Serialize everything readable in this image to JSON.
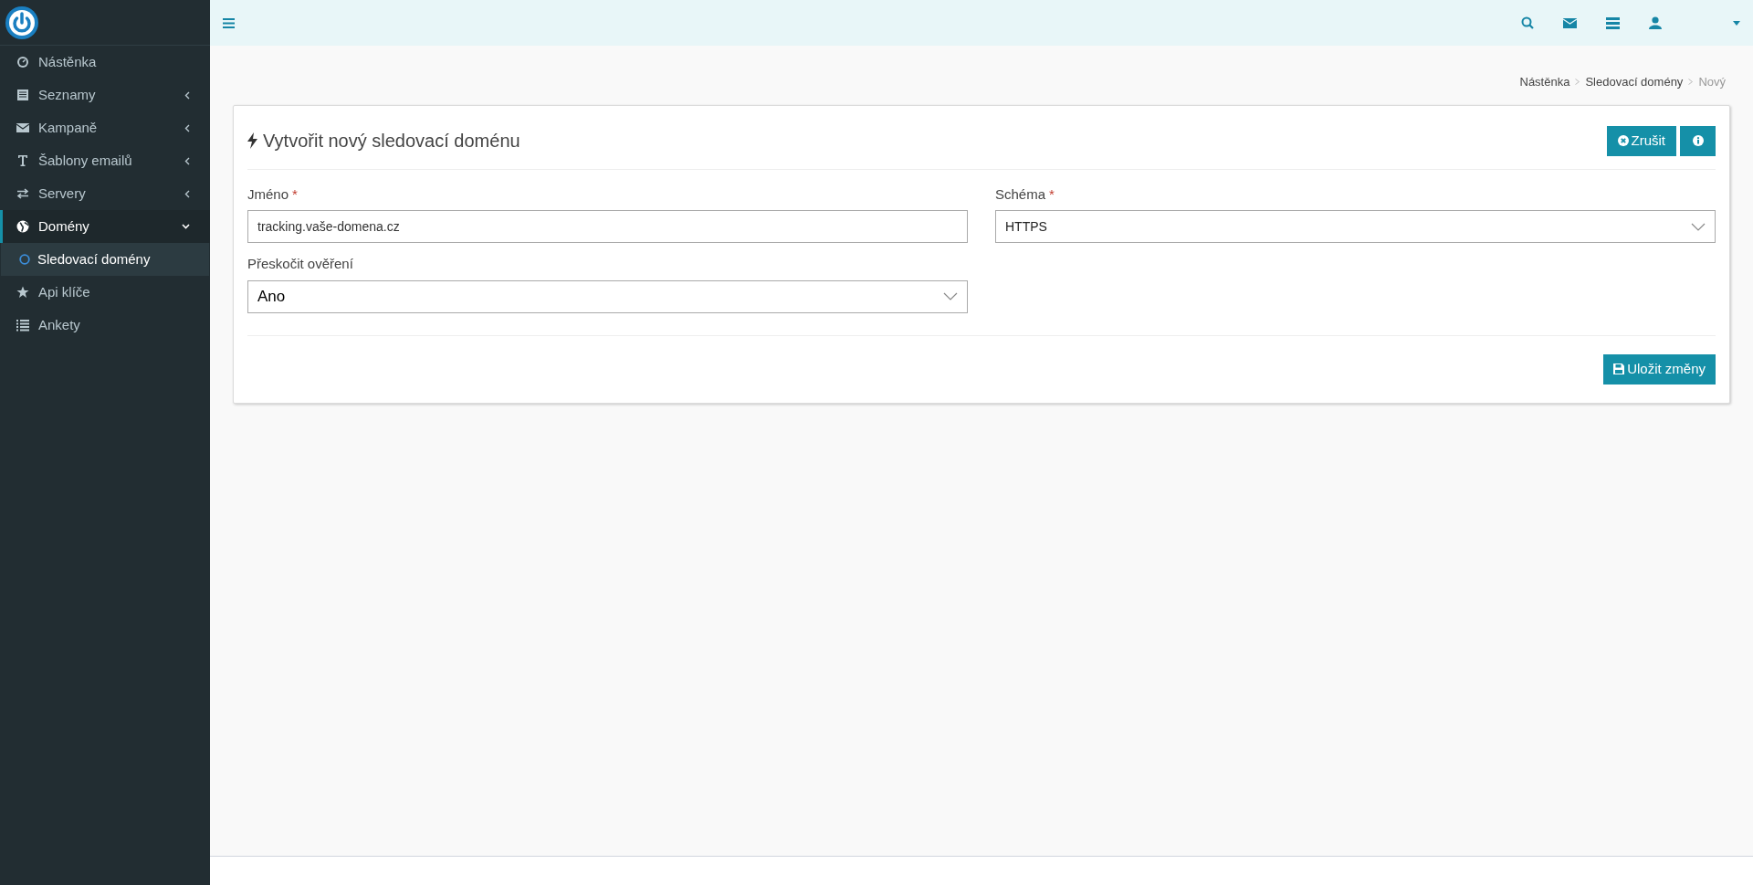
{
  "sidebar": {
    "items": [
      {
        "label": "Nástěnka",
        "kind": "link",
        "selected": false
      },
      {
        "label": "Seznamy",
        "kind": "group",
        "expanded": false,
        "selected": false
      },
      {
        "label": "Kampaně",
        "kind": "group",
        "expanded": false,
        "selected": false
      },
      {
        "label": "Šablony emailů",
        "kind": "group",
        "expanded": false,
        "selected": false
      },
      {
        "label": "Servery",
        "kind": "group",
        "expanded": false,
        "selected": false
      },
      {
        "label": "Domény",
        "kind": "group",
        "expanded": true,
        "selected": true,
        "children": [
          {
            "label": "Sledovací domény",
            "selected": true
          }
        ]
      },
      {
        "label": "Api klíče",
        "kind": "link",
        "selected": false
      },
      {
        "label": "Ankety",
        "kind": "link",
        "selected": false
      }
    ]
  },
  "breadcrumb": [
    "Nástěnka",
    "Sledovací domény",
    "Nový"
  ],
  "card": {
    "title": "Vytvořit nový sledovací doménu",
    "cancel_button": "Zrušit",
    "save_button": "Uložit změny",
    "fields": [
      {
        "kind": "text",
        "label": "Jméno",
        "required_mark": "*",
        "value": "tracking.vaše-domena.cz"
      },
      {
        "kind": "select",
        "label": "Schéma",
        "required_mark": "*",
        "value": "HTTPS"
      },
      {
        "kind": "select",
        "label": "Přeskočit ověření",
        "value": "Ano"
      }
    ]
  }
}
